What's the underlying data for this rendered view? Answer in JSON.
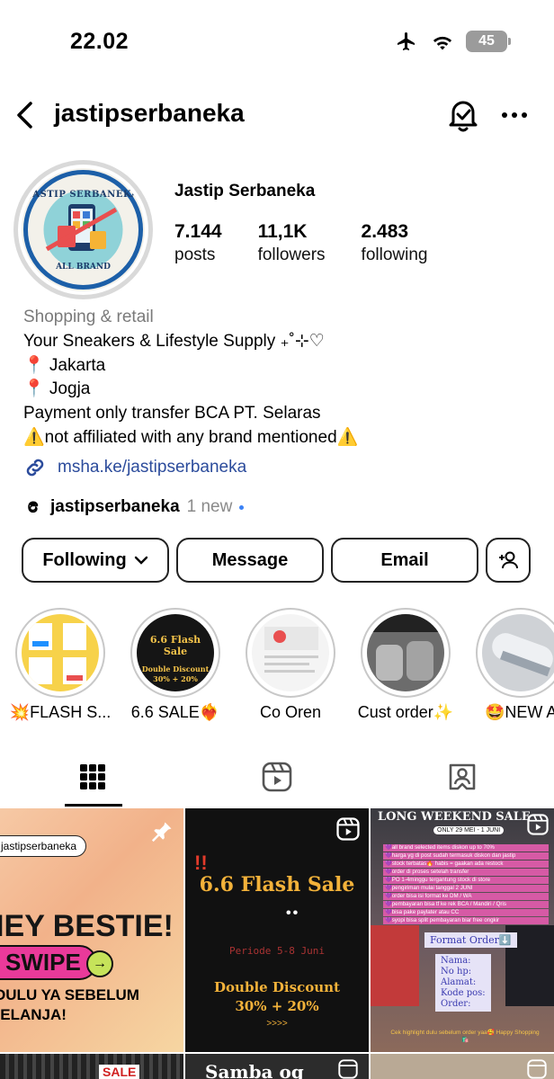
{
  "status_bar": {
    "time": "22.02",
    "battery": "45"
  },
  "header": {
    "username": "jastipserbaneka"
  },
  "profile": {
    "display_name": "Jastip Serbaneka",
    "avatar_text_top": "JASTIP SERBANEKA",
    "avatar_text_bottom": "ALL BRAND",
    "stats": [
      {
        "value": "7.144",
        "label": "posts"
      },
      {
        "value": "11,1K",
        "label": "followers"
      },
      {
        "value": "2.483",
        "label": "following"
      }
    ],
    "category": "Shopping & retail",
    "bio_lines": [
      "Your Sneakers & Lifestyle Supply ₊˚⊹♡",
      "📍 Jakarta",
      "📍 Jogja",
      "Payment only transfer BCA PT. Selaras",
      "⚠️not affiliated with any brand mentioned⚠️"
    ],
    "link": "msha.ke/jastipserbaneka",
    "threads_handle": "jastipserbaneka",
    "threads_new": "1 new"
  },
  "actions": {
    "following": "Following",
    "message": "Message",
    "email": "Email"
  },
  "highlights": [
    {
      "label": "💥FLASH S..."
    },
    {
      "label": "6.6 SALE❤️‍🔥",
      "img_title": "6.6 Flash Sale",
      "img_sub": "Double Discount",
      "img_sub2": "30% + 20%"
    },
    {
      "label": "Co Oren"
    },
    {
      "label": "Cust order✨"
    },
    {
      "label": "🤩NEW A"
    }
  ],
  "posts": [
    {
      "handle": "jastipserbaneka",
      "headline": "HEY BESTIE!",
      "pill": "SWIPE",
      "line1": "DULU YA SEBELUM",
      "line2": "BELANJA!"
    },
    {
      "title": "6.6 Flash Sale",
      "period": "Periode 5-8 Juni",
      "discount": "Double Discount",
      "discount_value": "30% + 20%",
      "arrows": ">>>>"
    },
    {
      "title": "LONG WEEKEND SALE",
      "subtitle": "ONLY 29 MEI - 1 JUNI",
      "notes": [
        "💜all brand selected items diskon up to 70%",
        "💜harga yg di post sudah termasuk diskon dan jastip",
        "💜stock terbatas🔥 habis = gaakan ada restock",
        "💜order di proses setelah transfer",
        "💜PO 1-4minggu tergantung stock di store",
        "💜pengiriman mulai tanggal 2 JUNI",
        "💜order bisa isi format ke DM / WA",
        "💜pembayaran bisa tf ke rek BCA / Mandiri / Qris",
        "💜bisa pake paylater atau CC",
        "💜syopi bisa split pembayaran biar free ongkir"
      ],
      "format_title": "Format Order⬇️",
      "format_fields": [
        "Nama:",
        "No hp:",
        "Alamat:",
        "Kode pos:",
        "Order:"
      ],
      "footer": "Cek highlight dulu sebelum order yaa🥰 Happy Shopping🛍️"
    }
  ],
  "next_posts": [
    {
      "text": "SALE"
    },
    {
      "text": "Samba og"
    },
    {
      "text": ""
    }
  ],
  "colors": {
    "link": "#2c4c9c",
    "accent_yellow": "#f5c44a",
    "post_bg_dark": "#111111"
  }
}
